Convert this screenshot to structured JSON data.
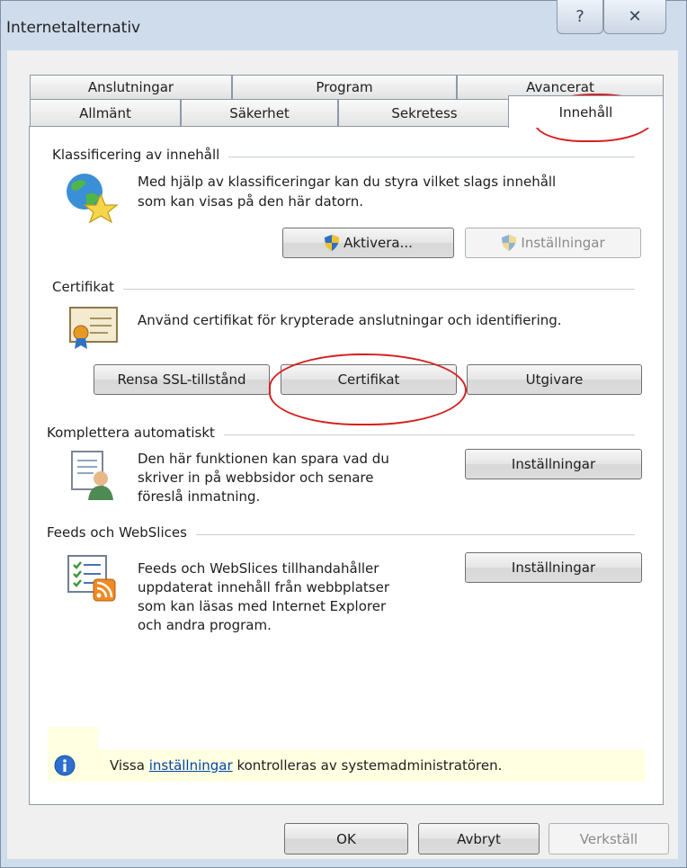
{
  "window": {
    "title": "Internetalternativ",
    "help_symbol": "?",
    "close_symbol": "✕"
  },
  "tabs": {
    "back_row": [
      "Anslutningar",
      "Program",
      "Avancerat"
    ],
    "front_row": [
      "Allmänt",
      "Säkerhet",
      "Sekretess",
      "Innehåll"
    ],
    "active": "Innehåll"
  },
  "content_rating": {
    "title": "Klassificering av innehåll",
    "description_line1": "Med hjälp av klassificeringar kan du styra vilket slags innehåll",
    "description_line2": "som kan visas på den här datorn.",
    "enable_button": "Aktivera...",
    "settings_button": "Inställningar"
  },
  "certificates": {
    "title": "Certifikat",
    "description": "Använd certifikat för krypterade anslutningar och identifiering.",
    "clear_ssl_button": "Rensa SSL-tillstånd",
    "certificates_button": "Certifikat",
    "publishers_button": "Utgivare"
  },
  "autocomplete": {
    "title": "Komplettera automatiskt",
    "description_line1": "Den här funktionen kan spara vad du",
    "description_line2": "skriver in på webbsidor och senare",
    "description_line3": "föreslå inmatning.",
    "settings_button": "Inställningar"
  },
  "feeds": {
    "title": "Feeds och WebSlices",
    "description_line1": "Feeds och WebSlices tillhandahåller",
    "description_line2": "uppdaterat innehåll från webbplatser",
    "description_line3": "som kan läsas med Internet Explorer",
    "description_line4": "och andra program.",
    "settings_button": "Inställningar"
  },
  "notice": {
    "prefix": "Vissa ",
    "link": "inställningar",
    "suffix": " kontrolleras av systemadministratören."
  },
  "footer": {
    "ok": "OK",
    "cancel": "Avbryt",
    "apply": "Verkställ"
  },
  "colors": {
    "annotation": "#d62020",
    "panel": "#ffffff",
    "dialog": "#f0f0f0",
    "notice": "#ffffe1"
  }
}
